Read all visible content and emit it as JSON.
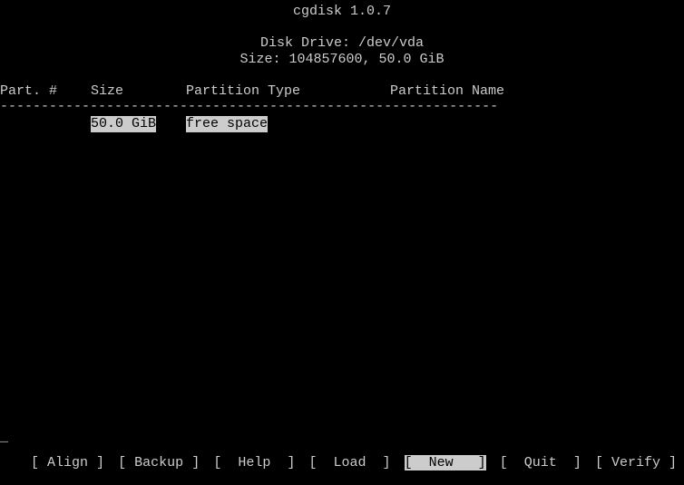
{
  "header": {
    "title": "cgdisk 1.0.7",
    "drive_label": "Disk Drive: /dev/vda",
    "size_label": "Size: 104857600, 50.0 GiB"
  },
  "columns": {
    "part": "Part. #",
    "size": "Size",
    "type": "Partition Type",
    "name": "Partition Name"
  },
  "divider": "-------------------------------------------------------------",
  "rows": [
    {
      "part": "",
      "size": "50.0 GiB",
      "type": "free space",
      "name": "",
      "selected": true
    }
  ],
  "cursor": "_",
  "menu": {
    "bracket_l": "[",
    "bracket_r": "]",
    "items": [
      {
        "label": " Align ",
        "selected": false
      },
      {
        "label": " Backup ",
        "selected": false
      },
      {
        "label": "  Help  ",
        "selected": false
      },
      {
        "label": "  Load  ",
        "selected": false
      },
      {
        "label": "  New   ",
        "selected": true
      },
      {
        "label": "  Quit  ",
        "selected": false
      },
      {
        "label": " Verify ",
        "selected": false
      }
    ]
  }
}
